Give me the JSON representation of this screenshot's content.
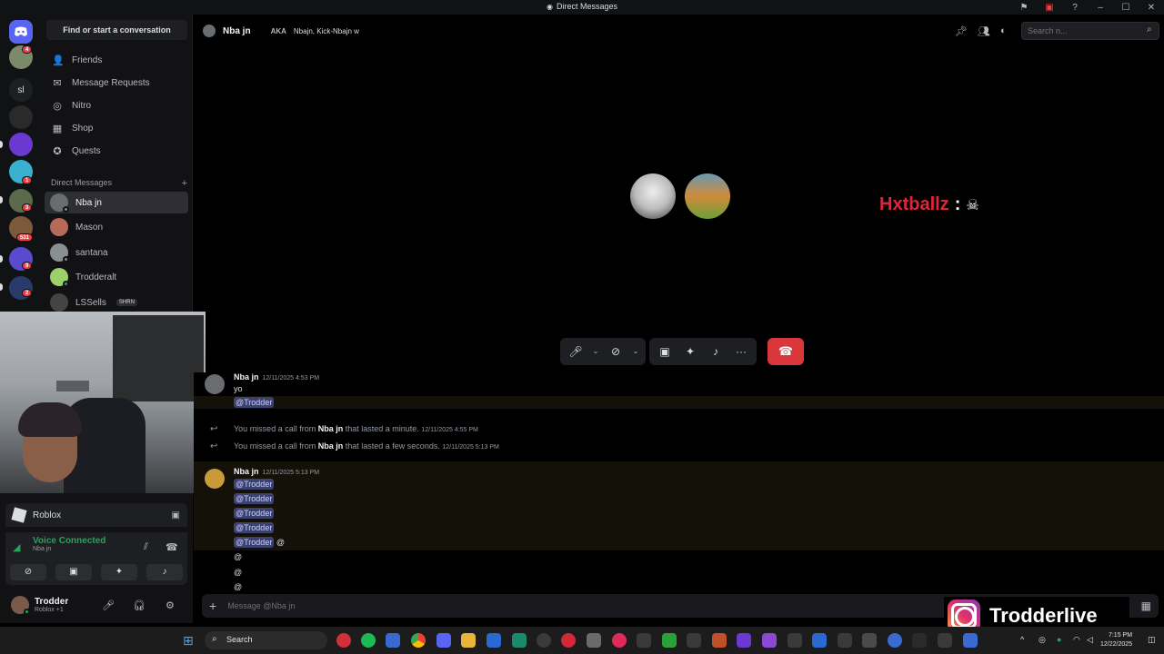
{
  "window": {
    "title": "Direct Messages"
  },
  "rail": {
    "text_server": "sl",
    "badges": [
      "4",
      "1",
      "3",
      "531",
      "9",
      "2"
    ]
  },
  "sidebar": {
    "find_button": "Find or start a conversation",
    "nav": [
      {
        "label": "Friends",
        "icon": "friends-icon"
      },
      {
        "label": "Message Requests",
        "icon": "mail-icon"
      },
      {
        "label": "Nitro",
        "icon": "nitro-icon"
      },
      {
        "label": "Shop",
        "icon": "shop-icon"
      },
      {
        "label": "Quests",
        "icon": "quests-icon"
      }
    ],
    "dm_header": "Direct Messages",
    "dms": [
      {
        "name": "Nba jn",
        "color": "#6a6d70"
      },
      {
        "name": "Mason",
        "color": "#b86a5a"
      },
      {
        "name": "santana",
        "color": "#8a8f94"
      },
      {
        "name": "Trodderalt",
        "color": "#9bd06a"
      },
      {
        "name": "LSSells",
        "tag": "SHRN",
        "color": "#444"
      }
    ]
  },
  "panel": {
    "app": "Roblox",
    "voice_status": "Voice Connected",
    "voice_channel": "Nba jn",
    "user_name": "Trodder",
    "user_status": "Roblox +1"
  },
  "header": {
    "name": "Nba jn",
    "aka_label": "AKA",
    "aka_values": "Nbajn, Kick-Nbajn w",
    "search_placeholder": "Search n..."
  },
  "call": {
    "overlay_name": "Hxtballz",
    "overlay_colon": ":"
  },
  "messages": {
    "group1": {
      "author": "Nba jn",
      "time": "12/11/2025 4:53 PM",
      "lines": [
        "yo",
        "@Trodder"
      ]
    },
    "system": [
      {
        "prefix": "You missed a call from",
        "who": "Nba jn",
        "suffix": "that lasted a minute.",
        "time": "12/11/2025 4:55 PM"
      },
      {
        "prefix": "You missed a call from",
        "who": "Nba jn",
        "suffix": "that lasted a few seconds.",
        "time": "12/11/2025 5:13 PM"
      }
    ],
    "group2": {
      "author": "Nba jn",
      "time": "12/11/2025 5:13 PM",
      "mention": "@Trodder",
      "trailing": "@"
    }
  },
  "composer": {
    "placeholder": "Message @Nba jn"
  },
  "watermark": {
    "text": "Trodderlive"
  },
  "taskbar": {
    "search": "Search",
    "time": "7:15 PM",
    "date": "12/22/2025"
  },
  "colors": {
    "accent": "#5865f2",
    "danger": "#da373c",
    "online": "#23a55a",
    "overlay_name": "#e0243a"
  }
}
